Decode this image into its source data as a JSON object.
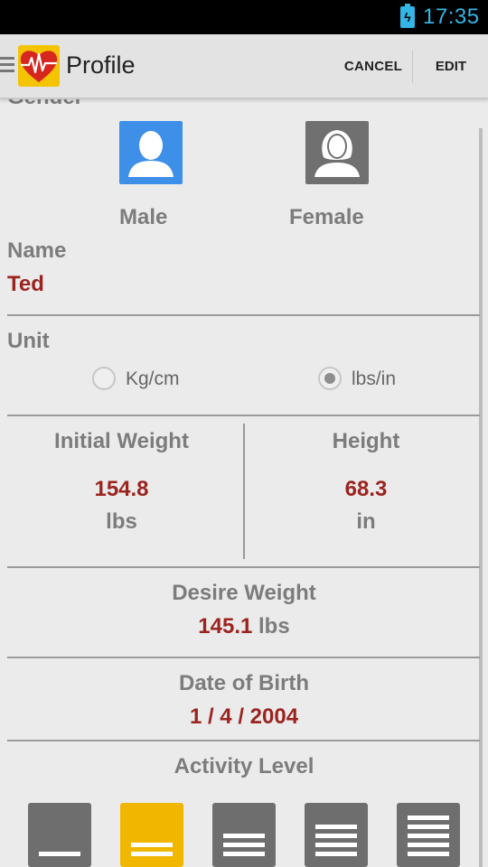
{
  "status_bar": {
    "time": "17:35",
    "battery_icon": "battery-charging-icon"
  },
  "action_bar": {
    "title": "Profile",
    "cancel_label": "CANCEL",
    "edit_label": "EDIT",
    "logo_icon": "heart-pulse-icon",
    "drawer_icon": "drawer-menu-icon"
  },
  "gender": {
    "label": "Gender",
    "male_label": "Male",
    "female_label": "Female",
    "selected": "Male"
  },
  "name": {
    "label": "Name",
    "value": "Ted"
  },
  "unit": {
    "label": "Unit",
    "options": [
      "Kg/cm",
      "lbs/in"
    ],
    "selected": "lbs/in"
  },
  "initial_weight": {
    "label": "Initial Weight",
    "value": "154.8",
    "unit": "lbs"
  },
  "height": {
    "label": "Height",
    "value": "68.3",
    "unit": "in"
  },
  "desire_weight": {
    "label": "Desire Weight",
    "value": "145.1",
    "unit": "lbs"
  },
  "date_of_birth": {
    "label": "Date of Birth",
    "value": "1 / 4 / 2004"
  },
  "activity_level": {
    "label": "Activity Level",
    "levels": 5,
    "selected_level": 2
  },
  "colors": {
    "accent_value": "#9b2420",
    "male_blue": "#3d8fe8",
    "activity_selected": "#f0b600",
    "clock_blue": "#33b5e5"
  }
}
